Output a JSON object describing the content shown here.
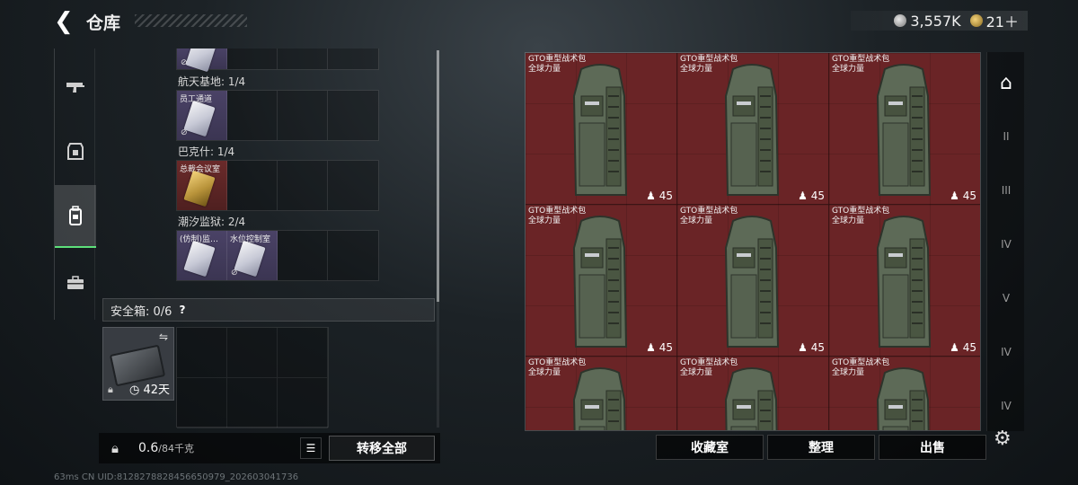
{
  "header": {
    "title": "仓库",
    "back_icon": "back-arrow-icon",
    "currencies": [
      {
        "name": "silver-coin-icon",
        "value": "3,557K"
      },
      {
        "name": "gold-coin-icon",
        "value": "21＋"
      }
    ]
  },
  "left_nav": [
    {
      "name": "gun-icon",
      "active": false
    },
    {
      "name": "armor-icon",
      "active": false
    },
    {
      "name": "backpack-icon",
      "active": true
    },
    {
      "name": "briefcase-icon",
      "active": false
    }
  ],
  "keycards": {
    "sections": [
      {
        "label": "航天基地: 1/4",
        "slots": [
          {
            "caption": "员工通道",
            "type": "card"
          }
        ]
      },
      {
        "label": "巴克什: 1/4",
        "slots": [
          {
            "caption": "总裁会议室",
            "type": "gold"
          }
        ]
      },
      {
        "label": "潮汐监狱: 2/4",
        "slots": [
          {
            "caption": "(仿制)监…",
            "type": "card"
          },
          {
            "caption": "水位控制室",
            "type": "card"
          }
        ]
      }
    ]
  },
  "safe": {
    "label": "安全箱: 0/6",
    "help": "?",
    "days": "42天"
  },
  "bottom_left": {
    "weight": "0.6",
    "capacity": "/84千克",
    "transfer_all": "转移全部"
  },
  "storage": {
    "items": [
      {
        "name_line1": "GTO重型战术包",
        "name_line2": "全球力量",
        "weight": "45"
      },
      {
        "name_line1": "GTO重型战术包",
        "name_line2": "全球力量",
        "weight": "45"
      },
      {
        "name_line1": "GTO重型战术包",
        "name_line2": "全球力量",
        "weight": "45"
      },
      {
        "name_line1": "GTO重型战术包",
        "name_line2": "全球力量",
        "weight": "45"
      },
      {
        "name_line1": "GTO重型战术包",
        "name_line2": "全球力量",
        "weight": "45"
      },
      {
        "name_line1": "GTO重型战术包",
        "name_line2": "全球力量",
        "weight": "45"
      },
      {
        "name_line1": "GTO重型战术包",
        "name_line2": "全球力量",
        "weight": ""
      },
      {
        "name_line1": "GTO重型战术包",
        "name_line2": "全球力量",
        "weight": ""
      },
      {
        "name_line1": "GTO重型战术包",
        "name_line2": "全球力量",
        "weight": ""
      }
    ]
  },
  "actions": {
    "collection": "收藏室",
    "sort": "整理",
    "sell": "出售"
  },
  "right_rail": [
    {
      "label": "⌂",
      "active": true
    },
    {
      "label": "II",
      "active": false
    },
    {
      "label": "III",
      "active": false
    },
    {
      "label": "IV",
      "active": false
    },
    {
      "label": "V",
      "active": false
    },
    {
      "label": "IV",
      "active": false
    },
    {
      "label": "IV",
      "active": false
    }
  ],
  "footer": "63ms    CN UID:8128278828456650979_202603041736"
}
